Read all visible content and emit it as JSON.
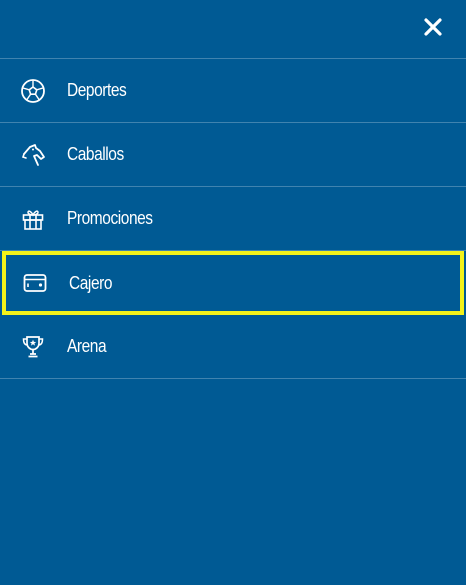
{
  "header": {
    "close_icon": "close-icon"
  },
  "menu": {
    "items": [
      {
        "label": "Deportes",
        "icon": "soccer-ball-icon",
        "selected": false
      },
      {
        "label": "Caballos",
        "icon": "horse-icon",
        "selected": false
      },
      {
        "label": "Promociones",
        "icon": "gift-icon",
        "selected": false
      },
      {
        "label": "Cajero",
        "icon": "wallet-card-icon",
        "selected": true
      },
      {
        "label": "Arena",
        "icon": "trophy-icon",
        "selected": false
      }
    ]
  },
  "colors": {
    "background": "#005a94",
    "text": "#ffffff",
    "divider": "rgba(255,255,255,0.25)",
    "highlight": "#f2f21a"
  }
}
